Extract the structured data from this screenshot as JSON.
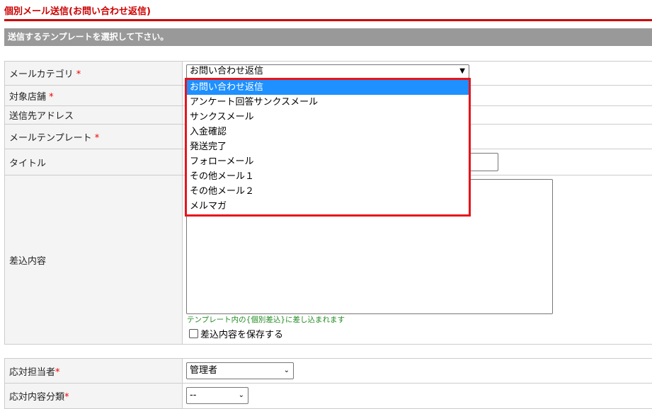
{
  "page_title": "個別メール送信(お問い合わせ返信)",
  "instruction": "送信するテンプレートを選択して下さい。",
  "required_mark": "*",
  "form": {
    "mail_category_label": "メールカテゴリ",
    "mail_category_value": "お問い合わせ返信",
    "store_label": "対象店舗",
    "address_label": "送信先アドレス",
    "template_label": "メールテンプレート",
    "subject_label": "タイトル",
    "insert_label": "差込内容",
    "insert_hint": "テンプレート内の{個別差込}に差し込まれます",
    "save_insert_label": "差込内容を保存する",
    "staff_label": "応対担当者",
    "staff_value": "管理者",
    "type_label": "応対内容分類",
    "type_value": "--"
  },
  "dropdown": {
    "options": [
      "お問い合わせ返信",
      "アンケート回答サンクスメール",
      "サンクスメール",
      "入金確認",
      "発送完了",
      "フォローメール",
      "その他メール１",
      "その他メール２",
      "メルマガ"
    ],
    "selected_index": 0
  }
}
